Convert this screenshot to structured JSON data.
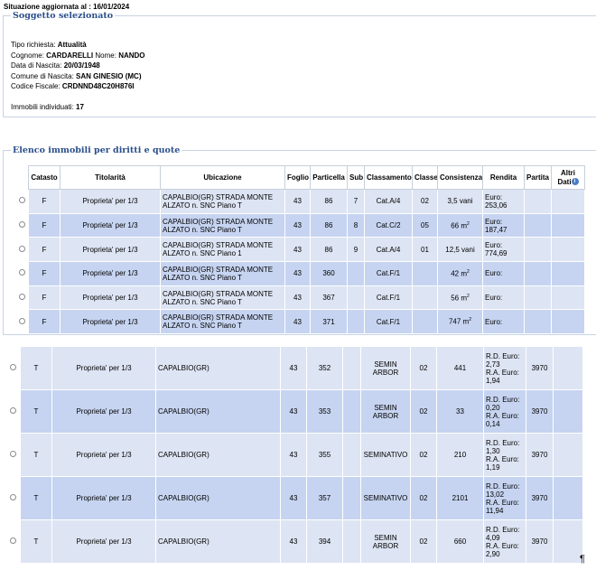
{
  "situation": "Situazione aggiornata al : 16/01/2024",
  "section1": {
    "legend": "Soggetto selezionato",
    "tipo_label": "Tipo richiesta:",
    "tipo_value": "Attualità",
    "cognome_label": "Cognome:",
    "cognome_value": "CARDARELLI",
    "nome_label": "Nome:",
    "nome_value": "NANDO",
    "nascita_label": "Data di Nascita:",
    "nascita_value": "20/03/1948",
    "comune_label": "Comune di Nascita:",
    "comune_value": "SAN GINESIO (MC)",
    "cf_label": "Codice Fiscale:",
    "cf_value": "CRDNND48C20H876I",
    "immobili_label": "Immobili individuati:",
    "immobili_value": "17"
  },
  "section2": {
    "legend": "Elenco immobili per diritti e quote",
    "headers": [
      "Catasto",
      "Titolarità",
      "Ubicazione",
      "Foglio",
      "Particella",
      "Sub",
      "Classamento",
      "Classe",
      "Consistenza",
      "Rendita",
      "Partita",
      "Altri Dati"
    ],
    "info_icon": "info-icon",
    "rows": [
      {
        "catasto": "F",
        "titolarita": "Proprieta' per 1/3",
        "ubic1": "CAPALBIO(GR) STRADA MONTE",
        "ubic2": "ALZATO n. SNC Piano T",
        "foglio": "43",
        "particella": "86",
        "sub": "7",
        "classamento": "Cat.A/4",
        "classe": "02",
        "consistenza": "3,5 vani",
        "rend1": "Euro:",
        "rend2": "253,06",
        "partita": ""
      },
      {
        "catasto": "F",
        "titolarita": "Proprieta' per 1/3",
        "ubic1": "CAPALBIO(GR) STRADA MONTE",
        "ubic2": "ALZATO n. SNC Piano T",
        "foglio": "43",
        "particella": "86",
        "sub": "8",
        "classamento": "Cat.C/2",
        "classe": "05",
        "consistenza": "66 m",
        "rend1": "Euro:",
        "rend2": "187,47",
        "partita": ""
      },
      {
        "catasto": "F",
        "titolarita": "Proprieta' per 1/3",
        "ubic1": "CAPALBIO(GR) STRADA MONTE",
        "ubic2": "ALZATO n. SNC Piano 1",
        "foglio": "43",
        "particella": "86",
        "sub": "9",
        "classamento": "Cat.A/4",
        "classe": "01",
        "consistenza": "12,5 vani",
        "rend1": "Euro:",
        "rend2": "774,69",
        "partita": ""
      },
      {
        "catasto": "F",
        "titolarita": "Proprieta' per 1/3",
        "ubic1": "CAPALBIO(GR) STRADA MONTE",
        "ubic2": "ALZATO n. SNC Piano T",
        "foglio": "43",
        "particella": "360",
        "sub": "",
        "classamento": "Cat.F/1",
        "classe": "",
        "consistenza": "42 m",
        "rend1": "Euro:",
        "rend2": "",
        "partita": ""
      },
      {
        "catasto": "F",
        "titolarita": "Proprieta' per 1/3",
        "ubic1": "CAPALBIO(GR) STRADA MONTE",
        "ubic2": "ALZATO n. SNC Piano T",
        "foglio": "43",
        "particella": "367",
        "sub": "",
        "classamento": "Cat.F/1",
        "classe": "",
        "consistenza": "56 m",
        "rend1": "Euro:",
        "rend2": "",
        "partita": ""
      },
      {
        "catasto": "F",
        "titolarita": "Proprieta' per 1/3",
        "ubic1": "CAPALBIO(GR) STRADA MONTE",
        "ubic2": "ALZATO n. SNC Piano T",
        "foglio": "43",
        "particella": "371",
        "sub": "",
        "classamento": "Cat.F/1",
        "classe": "",
        "consistenza": "747 m",
        "rend1": "Euro:",
        "rend2": "",
        "partita": ""
      }
    ]
  },
  "terreni": [
    {
      "catasto": "T",
      "titolarita": "Proprieta' per 1/3",
      "ubic": "CAPALBIO(GR)",
      "foglio": "43",
      "particella": "352",
      "sub": "",
      "qual1": "SEMIN",
      "qual2": "ARBOR",
      "classe": "02",
      "sup": "441",
      "r1": "R.D. Euro:",
      "r2": "2,73",
      "r3": "R.A. Euro:",
      "r4": "1,94",
      "partita": "3970"
    },
    {
      "catasto": "T",
      "titolarita": "Proprieta' per 1/3",
      "ubic": "CAPALBIO(GR)",
      "foglio": "43",
      "particella": "353",
      "sub": "",
      "qual1": "SEMIN",
      "qual2": "ARBOR",
      "classe": "02",
      "sup": "33",
      "r1": "R.D. Euro:",
      "r2": "0,20",
      "r3": "R.A. Euro:",
      "r4": "0,14",
      "partita": "3970"
    },
    {
      "catasto": "T",
      "titolarita": "Proprieta' per 1/3",
      "ubic": "CAPALBIO(GR)",
      "foglio": "43",
      "particella": "355",
      "sub": "",
      "qual1": "SEMINATIVO",
      "qual2": "",
      "classe": "02",
      "sup": "210",
      "r1": "R.D. Euro:",
      "r2": "1,30",
      "r3": "R.A. Euro:",
      "r4": "1,19",
      "partita": "3970"
    },
    {
      "catasto": "T",
      "titolarita": "Proprieta' per 1/3",
      "ubic": "CAPALBIO(GR)",
      "foglio": "43",
      "particella": "357",
      "sub": "",
      "qual1": "SEMINATIVO",
      "qual2": "",
      "classe": "02",
      "sup": "2101",
      "r1": "R.D. Euro:",
      "r2": "13,02",
      "r3": "R.A. Euro:",
      "r4": "11,94",
      "partita": "3970"
    },
    {
      "catasto": "T",
      "titolarita": "Proprieta' per 1/3",
      "ubic": "CAPALBIO(GR)",
      "foglio": "43",
      "particella": "394",
      "sub": "",
      "qual1": "SEMIN",
      "qual2": "ARBOR",
      "classe": "02",
      "sup": "660",
      "r1": "R.D. Euro:",
      "r2": "4,09",
      "r3": "R.A. Euro:",
      "r4": "2,90",
      "partita": "3970"
    }
  ],
  "pilcrow": "¶"
}
